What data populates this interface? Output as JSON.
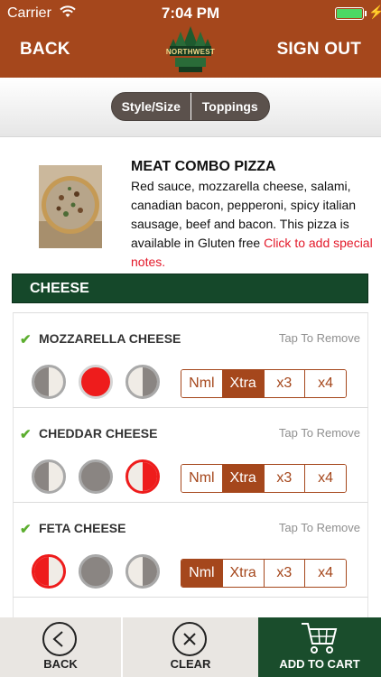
{
  "status": {
    "carrier": "Carrier",
    "time": "7:04 PM",
    "battery_color": "#4cd964"
  },
  "header": {
    "back_label": "BACK",
    "signout_label": "SIGN OUT",
    "logo_text": "NORTHWEST",
    "bg_color": "#a5471c"
  },
  "tabs": [
    {
      "label": "Style/Size"
    },
    {
      "label": "Toppings"
    }
  ],
  "product": {
    "title": "MEAT COMBO PIZZA",
    "description": "Red sauce, mozzarella cheese, salami, canadian bacon, pepperoni, spicy italian sausage, beef and bacon. This pizza is available in Gluten free ",
    "notes_link": "Click to add special notes."
  },
  "section": {
    "title": "CHEESE",
    "color": "#15482a"
  },
  "toppings": [
    {
      "name": "MOZZARELLA CHEESE",
      "remove_label": "Tap To Remove",
      "coverage": [
        "left",
        "whole",
        "right"
      ],
      "selected_coverage": "whole",
      "amounts": [
        "Nml",
        "Xtra",
        "x3",
        "x4"
      ],
      "selected_amount": "Xtra"
    },
    {
      "name": "CHEDDAR CHEESE",
      "remove_label": "Tap To Remove",
      "coverage": [
        "left",
        "whole",
        "right"
      ],
      "selected_coverage": "right",
      "amounts": [
        "Nml",
        "Xtra",
        "x3",
        "x4"
      ],
      "selected_amount": "Xtra"
    },
    {
      "name": "FETA CHEESE",
      "remove_label": "Tap To Remove",
      "coverage": [
        "left",
        "whole",
        "right"
      ],
      "selected_coverage": "left",
      "amounts": [
        "Nml",
        "Xtra",
        "x3",
        "x4"
      ],
      "selected_amount": "Nml"
    }
  ],
  "bottom_bar": {
    "back_label": "BACK",
    "clear_label": "CLEAR",
    "cart_label": "ADD TO CART",
    "cart_color": "#1a4d2c"
  },
  "icons": [
    "wifi-icon",
    "battery-icon",
    "charging-icon",
    "logo-tree-icon",
    "check-icon",
    "back-arrow-icon",
    "clear-x-icon",
    "cart-icon"
  ]
}
